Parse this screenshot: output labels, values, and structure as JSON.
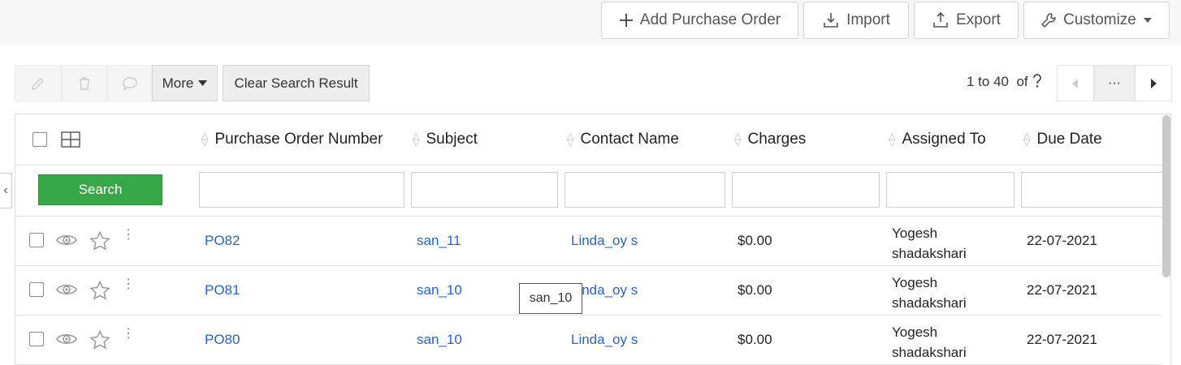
{
  "toolbar": {
    "add_purchase_order": "Add Purchase Order",
    "import": "Import",
    "export": "Export",
    "customize": "Customize"
  },
  "listbar": {
    "more": "More",
    "clear_search": "Clear Search Result",
    "pager_range": "1 to 40",
    "pager_of": "of",
    "pager_more": "···"
  },
  "table": {
    "columns": [
      "Purchase Order Number",
      "Subject",
      "Contact Name",
      "Charges",
      "Assigned To",
      "Due Date"
    ],
    "search_label": "Search",
    "rows": [
      {
        "po": "PO82",
        "subject": "san_11",
        "contact": "Linda_oy s",
        "charges": "$0.00",
        "assigned_line1": "Yogesh",
        "assigned_line2": "shadakshari",
        "due": "22-07-2021"
      },
      {
        "po": "PO81",
        "subject": "san_10",
        "contact": "Linda_oy s",
        "charges": "$0.00",
        "assigned_line1": "Yogesh",
        "assigned_line2": "shadakshari",
        "due": "22-07-2021"
      },
      {
        "po": "PO80",
        "subject": "san_10",
        "contact": "Linda_oy s",
        "charges": "$0.00",
        "assigned_line1": "Yogesh",
        "assigned_line2": "shadakshari",
        "due": "22-07-2021"
      }
    ]
  },
  "tooltip": "san_10",
  "colors": {
    "accent_green": "#36a847",
    "link_blue": "#2b62c2"
  },
  "icons": [
    "plus-icon",
    "import-icon",
    "export-icon",
    "wrench-icon",
    "pencil-icon",
    "trash-icon",
    "comment-icon",
    "help-icon",
    "eye-icon",
    "star-icon"
  ]
}
